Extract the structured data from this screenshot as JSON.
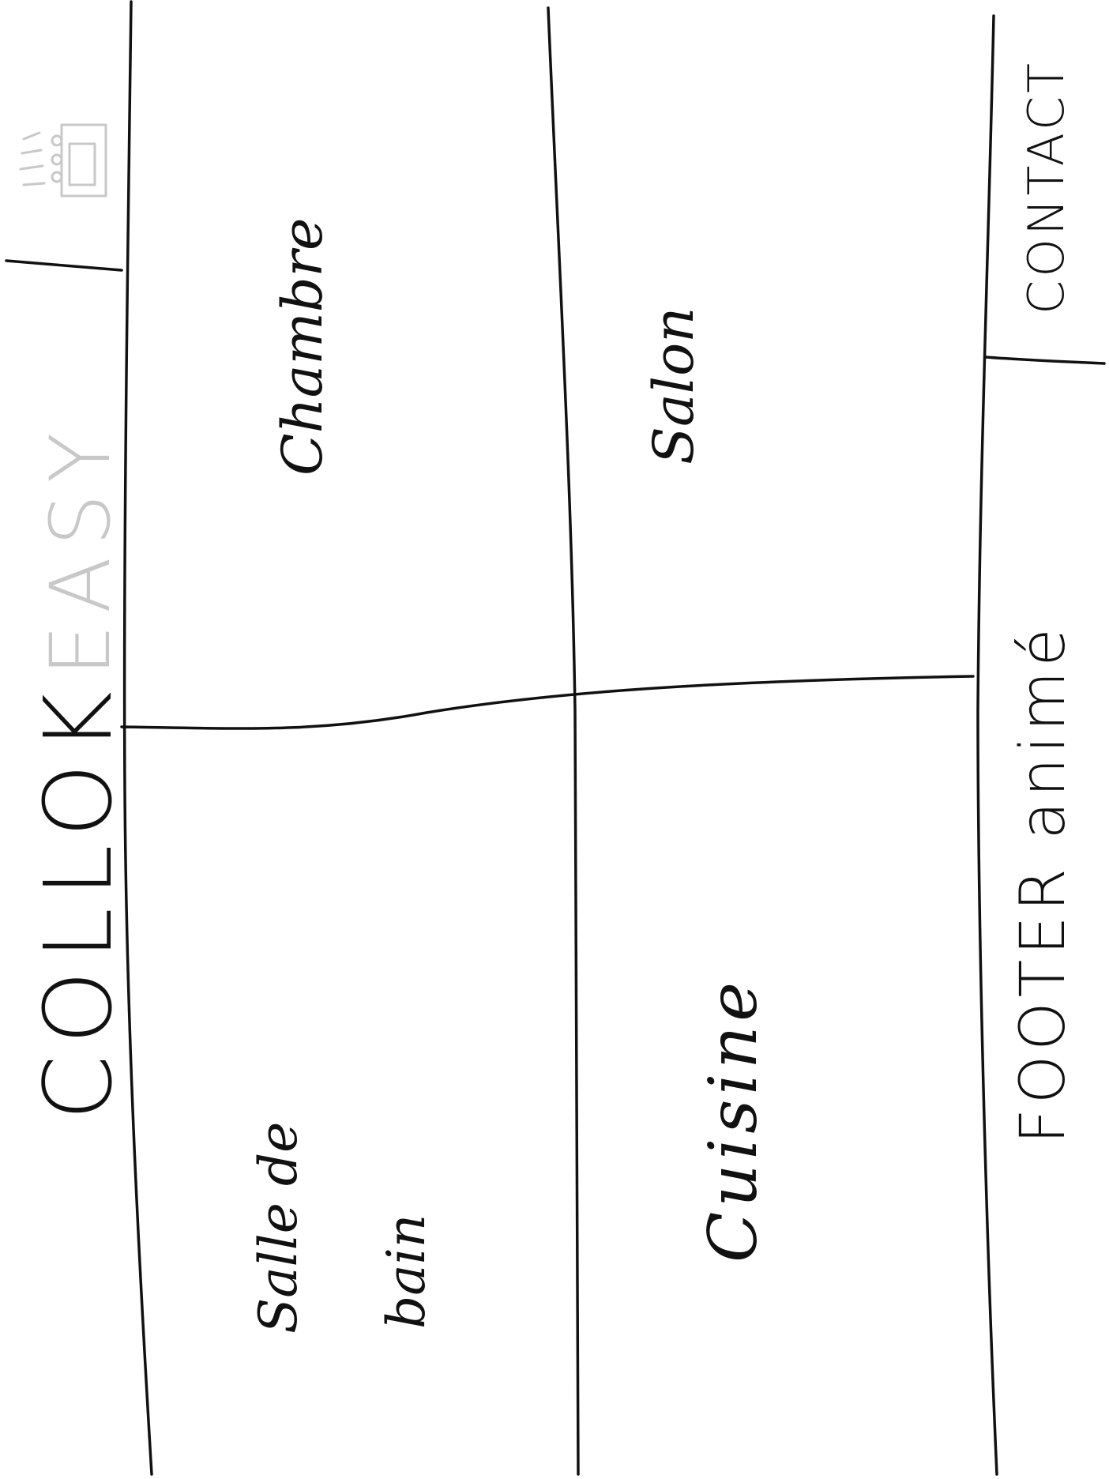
{
  "header": {
    "brand_primary": "COLLOK",
    "brand_secondary": "EASY",
    "logo_icon": "house-logo-icon",
    "brand_color": "#111111",
    "brand_secondary_color": "#c8c8c8"
  },
  "rooms": {
    "chambre": "Chambre",
    "salon": "Salon",
    "salle_de_bain_line1": "Salle de",
    "salle_de_bain_line2": "bain",
    "cuisine": "Cuisine"
  },
  "footer": {
    "label": "FOOTER animé",
    "contact": "CONTACT"
  }
}
